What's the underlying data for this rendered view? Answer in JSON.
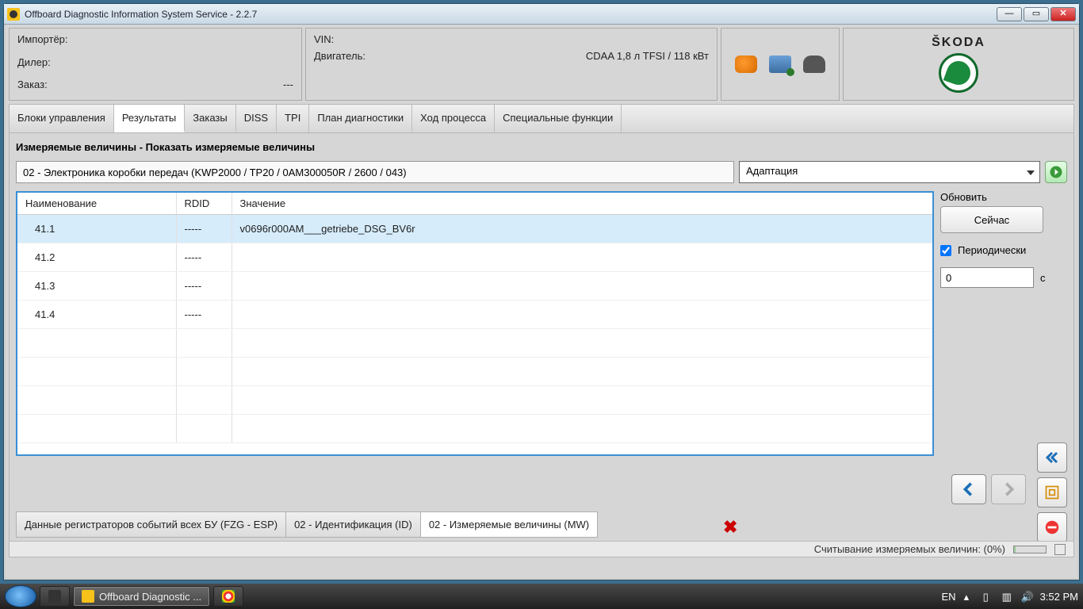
{
  "window": {
    "title": "Offboard Diagnostic Information System Service - 2.2.7"
  },
  "header": {
    "importer_label": "Импортёр:",
    "dealer_label": "Дилер:",
    "order_label": "Заказ:",
    "order_value": "---",
    "vin_label": "VIN:",
    "engine_label": "Двигатель:",
    "engine_value": "CDAA 1,8 л TFSI / 118 кВт",
    "brand": "ŠKODA"
  },
  "tabs": [
    "Блоки управления",
    "Результаты",
    "Заказы",
    "DISS",
    "TPI",
    "План диагностики",
    "Ход процесса",
    "Специальные функции"
  ],
  "active_tab": 1,
  "section_title": "Измеряемые величины - Показать измеряемые величины",
  "selector_text": "02 - Электроника коробки передач  (KWP2000 / TP20 / 0AM300050R   / 2600 / 043)",
  "combo_value": "Адаптация",
  "table": {
    "headers": [
      "Наименование",
      "RDID",
      "Значение"
    ],
    "rows": [
      {
        "name": "41.1",
        "rdid": "-----",
        "value": "v0696r000AM___getriebe_DSG_BV6r",
        "selected": true
      },
      {
        "name": "41.2",
        "rdid": "-----",
        "value": ""
      },
      {
        "name": "41.3",
        "rdid": "-----",
        "value": ""
      },
      {
        "name": "41.4",
        "rdid": "-----",
        "value": ""
      }
    ]
  },
  "sidebar": {
    "refresh_label": "Обновить",
    "now_button": "Сейчас",
    "periodic_label": "Периодически",
    "periodic_checked": true,
    "interval_value": "0",
    "interval_unit": "с"
  },
  "bottom_tabs": [
    "Данные регистраторов событий всех БУ (FZG - ESP)",
    "02 - Идентификация (ID)",
    "02 - Измеряемые величины (MW)"
  ],
  "active_bottom_tab": 2,
  "status": {
    "text": "Считывание измеряемых величин: (0%)"
  },
  "taskbar": {
    "app_name": "Offboard Diagnostic ...",
    "lang": "EN",
    "time": "3:52 PM"
  }
}
